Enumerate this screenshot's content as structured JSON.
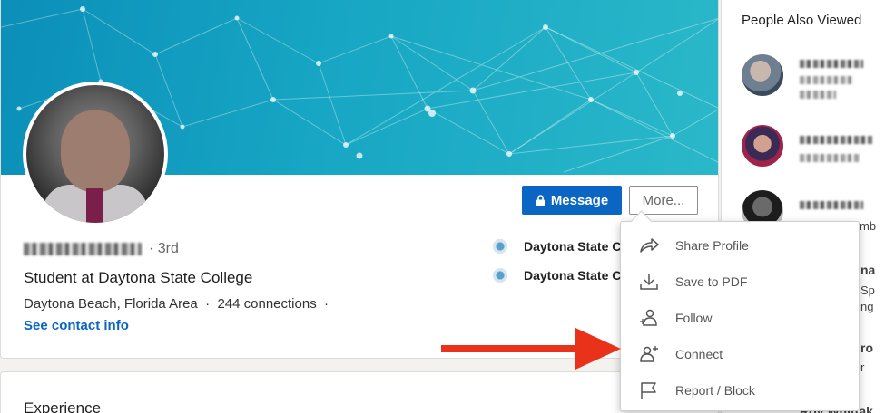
{
  "profile": {
    "connection_degree": "· 3rd",
    "headline": "Student at Daytona State College",
    "location_line": "Daytona Beach, Florida Area  ·  244 connections  ·",
    "contact_link": "See contact info",
    "education": [
      {
        "name": "Daytona State C"
      },
      {
        "name": "Daytona State C"
      }
    ]
  },
  "actions": {
    "message_label": "Message",
    "more_label": "More..."
  },
  "more_menu": {
    "items": [
      {
        "label": "Share Profile",
        "icon": "share-arrow-icon"
      },
      {
        "label": "Save to PDF",
        "icon": "download-icon"
      },
      {
        "label": "Follow",
        "icon": "follow-person-icon"
      },
      {
        "label": "Connect",
        "icon": "add-person-icon"
      },
      {
        "label": "Report / Block",
        "icon": "flag-icon"
      }
    ]
  },
  "sidebar": {
    "title": "People Also Viewed",
    "partial_texts": [
      "mb",
      "na",
      "Sp",
      "ng",
      "ro",
      "r",
      "Roy Whittak"
    ]
  },
  "experience": {
    "title": "Experience"
  },
  "colors": {
    "primary": "#0a66c2",
    "banner_start": "#0b8fb9",
    "banner_end": "#2ab8c9",
    "annotation_arrow": "#e8321a"
  }
}
